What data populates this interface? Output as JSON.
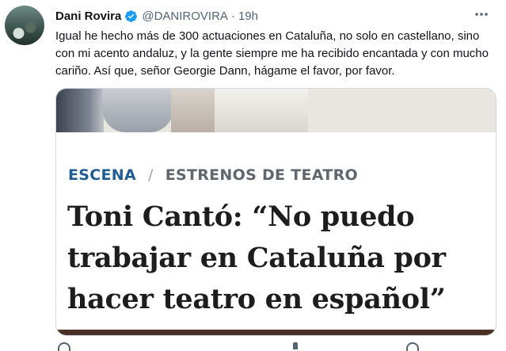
{
  "tweet": {
    "author_name": "Dani Rovira",
    "handle": "@DANIROVIRA",
    "separator": "·",
    "time": "19h",
    "text": "Igual he hecho más de 300 actuaciones en Cataluña, no solo en castellano, sino con mi acento andaluz, y la gente siempre me ha recibido encantada y con mucho cariño. Así que, señor Georgie Dann, hágame el favor, por favor."
  },
  "card": {
    "section": "ESCENA",
    "section_separator": "/",
    "subsection": "ESTRENOS DE TEATRO",
    "headline": "Toni Cantó: “No puedo trabajar en Cataluña por hacer teatro en español”"
  },
  "icons": {
    "verified": "verified-badge-icon",
    "more": "more-options-icon"
  },
  "colors": {
    "verified": "#1d9bf0",
    "secondary_text": "#536471",
    "section_blue": "#1f5d93",
    "card_bar": "#4b3125"
  }
}
